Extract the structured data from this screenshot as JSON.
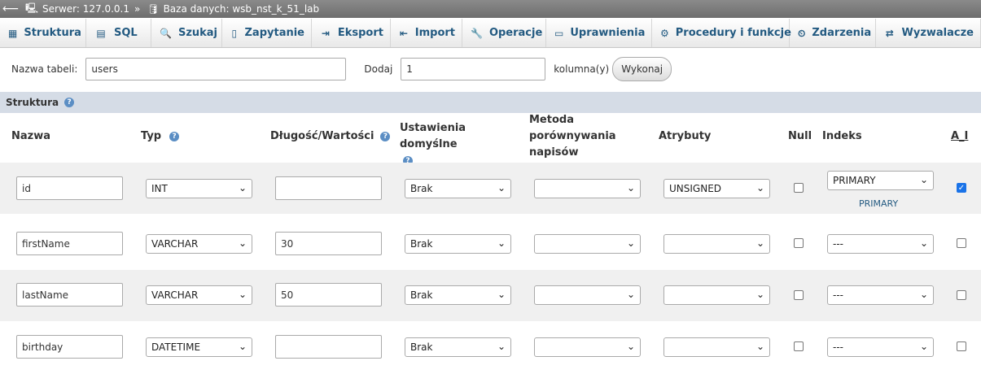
{
  "breadcrumb": {
    "server": "Serwer: 127.0.0.1",
    "separator": "»",
    "database": "Baza danych: wsb_nst_k_51_lab"
  },
  "tabs": [
    "Struktura",
    "SQL",
    "Szukaj",
    "Zapytanie",
    "Eksport",
    "Import",
    "Operacje",
    "Uprawnienia",
    "Procedury i funkcje",
    "Zdarzenia",
    "Wyzwalacze"
  ],
  "namerow": {
    "table_label": "Nazwa tabeli:",
    "table_value": "users",
    "add_label": "Dodaj",
    "add_value": "1",
    "columns_label": "kolumna(y)",
    "go_button": "Wykonaj"
  },
  "structure": {
    "title": "Struktura",
    "headers": {
      "name": "Nazwa",
      "type": "Typ",
      "length": "Długość/Wartości",
      "default": "Ustawienia domyślne",
      "collation": "Metoda porównywania napisów",
      "attributes": "Atrybuty",
      "null": "Null",
      "index": "Indeks",
      "ai": "A_I"
    },
    "rows": [
      {
        "name": "id",
        "type": "INT",
        "length": "",
        "default": "Brak",
        "collation": "",
        "attributes": "UNSIGNED",
        "null": false,
        "index": "PRIMARY",
        "index_link": "PRIMARY",
        "ai": true
      },
      {
        "name": "firstName",
        "type": "VARCHAR",
        "length": "30",
        "default": "Brak",
        "collation": "",
        "attributes": "",
        "null": false,
        "index": "---",
        "index_link": "",
        "ai": false
      },
      {
        "name": "lastName",
        "type": "VARCHAR",
        "length": "50",
        "default": "Brak",
        "collation": "",
        "attributes": "",
        "null": false,
        "index": "---",
        "index_link": "",
        "ai": false
      },
      {
        "name": "birthday",
        "type": "DATETIME",
        "length": "",
        "default": "Brak",
        "collation": "",
        "attributes": "",
        "null": false,
        "index": "---",
        "index_link": "",
        "ai": false
      }
    ]
  },
  "colors": {
    "link": "#235a81",
    "header_bg": "#d5dce6",
    "row_alt": "#f0f0f0",
    "check": "#1a73e8"
  }
}
